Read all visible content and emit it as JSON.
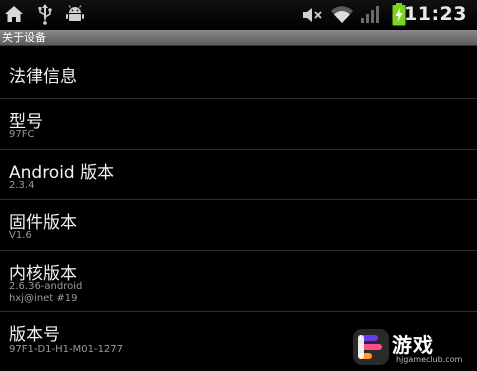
{
  "status_bar": {
    "time": "11:23",
    "icons": [
      "home-icon",
      "usb-icon",
      "android-debug-icon",
      "mute-icon",
      "wifi-icon",
      "signal-icon",
      "battery-charging-icon"
    ],
    "battery_color": "#7ed320"
  },
  "title_bar": {
    "title": "关于设备"
  },
  "items": [
    {
      "title": "法律信息"
    },
    {
      "title": "型号",
      "summary": "97FC"
    },
    {
      "title": "Android 版本",
      "summary": "2.3.4"
    },
    {
      "title": "固件版本",
      "summary": "V1.6"
    },
    {
      "title": "内核版本",
      "summary_lines": [
        "2.6.36-android",
        "hxj@inet #19"
      ]
    },
    {
      "title": "版本号",
      "summary": "97F1-D1-H1-M01-1277"
    }
  ],
  "watermark": {
    "text": "游戏",
    "url": "hjgameclub.com",
    "accent_colors": [
      "#6a3cf0",
      "#ff4d8a",
      "#ff9c2b"
    ]
  }
}
